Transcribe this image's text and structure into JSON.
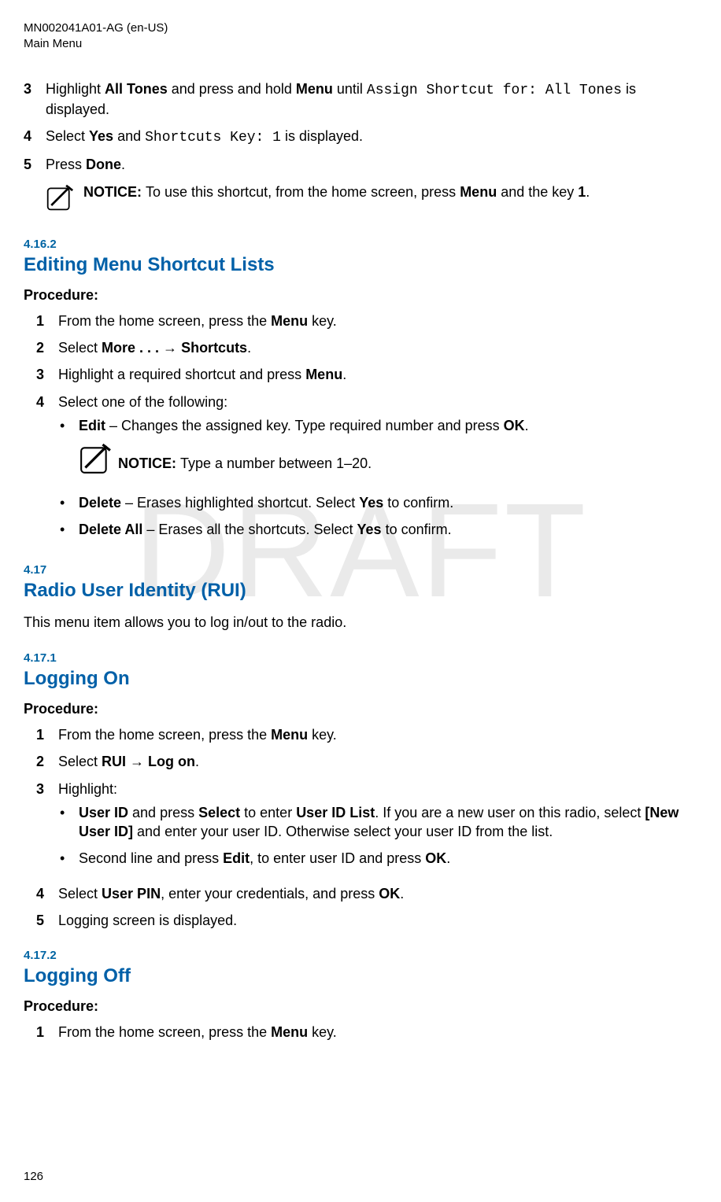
{
  "header": {
    "doc_code": "MN002041A01-AG (en-US)",
    "doc_section": "Main Menu"
  },
  "watermark": "DRAFT",
  "page_number": "126",
  "icons": {
    "notice_name": "notice-icon"
  },
  "cont_steps": {
    "s3": {
      "num": "3",
      "pre": "Highlight ",
      "b1": "All Tones",
      "mid1": " and press and hold ",
      "b2": "Menu",
      "mid2": " until ",
      "code": "Assign Shortcut for: All Tones",
      "post": " is displayed."
    },
    "s4": {
      "num": "4",
      "pre": "Select ",
      "b1": "Yes",
      "mid1": " and ",
      "code": "Shortcuts Key: 1",
      "post": " is displayed."
    },
    "s5": {
      "num": "5",
      "pre": "Press ",
      "b1": "Done",
      "post": "."
    },
    "notice": {
      "label": "NOTICE: ",
      "pre": "To use this shortcut, from the home screen, press ",
      "b1": "Menu",
      "mid1": " and the key ",
      "b2": "1",
      "post": "."
    }
  },
  "sec_4_16_2": {
    "num": "4.16.2",
    "title": "Editing Menu Shortcut Lists",
    "proc": "Procedure:",
    "s1": {
      "num": "1",
      "pre": "From the home screen, press the ",
      "b1": "Menu",
      "post": " key."
    },
    "s2": {
      "num": "2",
      "pre": "Select ",
      "b1": "More . . .",
      "arrow": " → ",
      "b2": "Shortcuts",
      "post": "."
    },
    "s3": {
      "num": "3",
      "pre": "Highlight a required shortcut and press ",
      "b1": "Menu",
      "post": "."
    },
    "s4": {
      "num": "4",
      "text": "Select one of the following:",
      "b_edit": {
        "label": "Edit",
        "rest": " – Changes the assigned key. Type required number and press ",
        "ok": "OK",
        "post": "."
      },
      "notice": {
        "label": "NOTICE: ",
        "text": "Type a number between 1–20."
      },
      "b_delete": {
        "label": "Delete",
        "rest": " – Erases highlighted shortcut. Select ",
        "yes": "Yes",
        "post": " to confirm."
      },
      "b_delete_all": {
        "label": "Delete All",
        "rest": " – Erases all the shortcuts. Select ",
        "yes": "Yes",
        "post": " to confirm."
      }
    }
  },
  "sec_4_17": {
    "num": "4.17",
    "title": "Radio User Identity (RUI)",
    "body": "This menu item allows you to log in/out to the radio."
  },
  "sec_4_17_1": {
    "num": "4.17.1",
    "title": "Logging On",
    "proc": "Procedure:",
    "s1": {
      "num": "1",
      "pre": "From the home screen, press the ",
      "b1": "Menu",
      "post": " key."
    },
    "s2": {
      "num": "2",
      "pre": "Select ",
      "b1": "RUI",
      "arrow": " → ",
      "b2": "Log on",
      "post": "."
    },
    "s3": {
      "num": "3",
      "text": "Highlight:",
      "b1": {
        "label": "User ID",
        "mid1": " and press ",
        "sel": "Select",
        "mid2": " to enter ",
        "list": "User ID List",
        "mid3": ". If you are a new user on this radio, select ",
        "newu": "[New User ID]",
        "post": " and enter your user ID. Otherwise select your user ID from the list."
      },
      "b2": {
        "pre": "Second line and press ",
        "edit": "Edit",
        "mid": ", to enter user ID and press ",
        "ok": "OK",
        "post": "."
      }
    },
    "s4": {
      "num": "4",
      "pre": "Select ",
      "b1": "User PIN",
      "mid": ", enter your credentials, and press ",
      "b2": "OK",
      "post": "."
    },
    "s5": {
      "num": "5",
      "text": "Logging screen is displayed."
    }
  },
  "sec_4_17_2": {
    "num": "4.17.2",
    "title": "Logging Off",
    "proc": "Procedure:",
    "s1": {
      "num": "1",
      "pre": "From the home screen, press the ",
      "b1": "Menu",
      "post": " key."
    }
  }
}
